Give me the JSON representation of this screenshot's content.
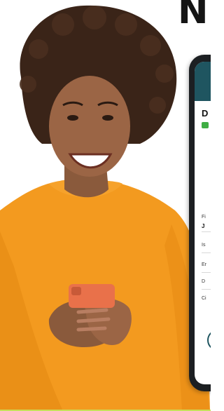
{
  "headline": {
    "text": "N"
  },
  "phone": {
    "screen_title": "D",
    "fields": [
      {
        "label": "Fi",
        "value": "J"
      },
      {
        "label": "Is",
        "value": ""
      },
      {
        "label": "Er",
        "value": ""
      },
      {
        "label": "D",
        "value": ""
      },
      {
        "label": "Ci",
        "value": ""
      }
    ],
    "accent_color": "#3fae44",
    "header_color": "#1f5560"
  },
  "photo": {
    "subject": "woman-holding-phone"
  }
}
